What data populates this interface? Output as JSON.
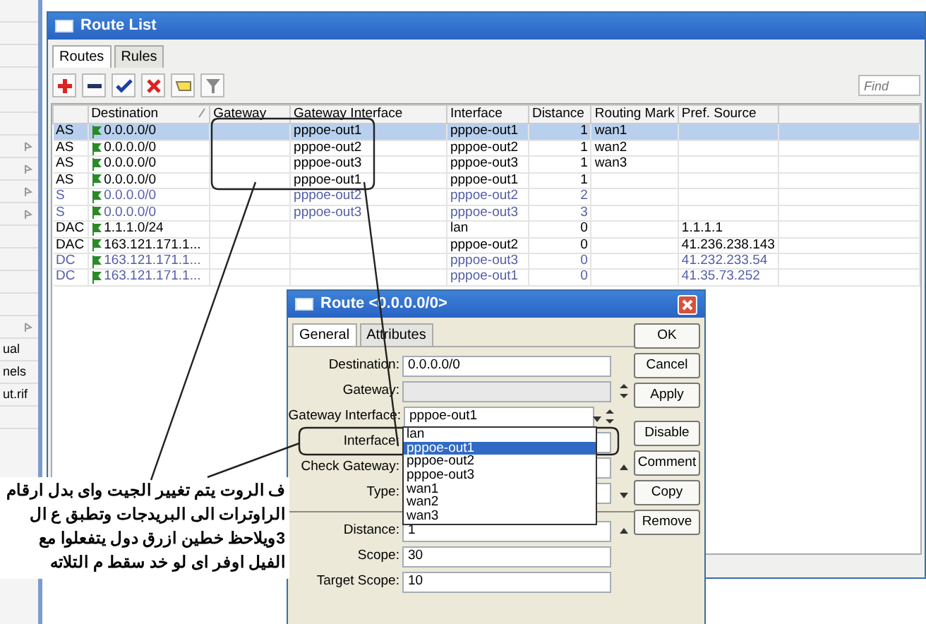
{
  "sidebar": {
    "items": [
      {
        "label": "ual"
      },
      {
        "label": "nels"
      },
      {
        "label": "ut.rif"
      }
    ]
  },
  "route_list": {
    "title": "Route List",
    "tabs": [
      {
        "label": "Routes",
        "selected": true
      },
      {
        "label": "Rules",
        "selected": false
      }
    ],
    "find": {
      "placeholder": "Find"
    },
    "columns": [
      "Destination",
      "Gateway",
      "Gateway Interface",
      "Interface",
      "Distance",
      "Routing Mark",
      "Pref. Source"
    ],
    "rows": [
      {
        "type": "AS",
        "destination": "0.0.0.0/0",
        "gateway_interface": "pppoe-out1",
        "interface": "pppoe-out1",
        "distance": "1",
        "routing_mark": "wan1",
        "selected": true,
        "inactive": false
      },
      {
        "type": "AS",
        "destination": "0.0.0.0/0",
        "gateway_interface": "pppoe-out2",
        "interface": "pppoe-out2",
        "distance": "1",
        "routing_mark": "wan2",
        "selected": false,
        "inactive": false
      },
      {
        "type": "AS",
        "destination": "0.0.0.0/0",
        "gateway_interface": "pppoe-out3",
        "interface": "pppoe-out3",
        "distance": "1",
        "routing_mark": "wan3",
        "selected": false,
        "inactive": false
      },
      {
        "type": "AS",
        "destination": "0.0.0.0/0",
        "gateway_interface": "pppoe-out1",
        "interface": "pppoe-out1",
        "distance": "1",
        "selected": false,
        "inactive": false
      },
      {
        "type": "S",
        "destination": "0.0.0.0/0",
        "gateway_interface": "pppoe-out2",
        "interface": "pppoe-out2",
        "distance": "2",
        "selected": false,
        "inactive": true
      },
      {
        "type": "S",
        "destination": "0.0.0.0/0",
        "gateway_interface": "pppoe-out3",
        "interface": "pppoe-out3",
        "distance": "3",
        "selected": false,
        "inactive": true
      },
      {
        "type": "DAC",
        "destination": "1.1.1.0/24",
        "interface": "lan",
        "distance": "0",
        "pref_source": "1.1.1.1",
        "selected": false,
        "inactive": false
      },
      {
        "type": "DAC",
        "destination": "163.121.171.1...",
        "interface": "pppoe-out2",
        "distance": "0",
        "pref_source": "41.236.238.143",
        "selected": false,
        "inactive": false
      },
      {
        "type": "DC",
        "destination": "163.121.171.1...",
        "interface": "pppoe-out3",
        "distance": "0",
        "pref_source": "41.232.233.54",
        "selected": false,
        "inactive": true
      },
      {
        "type": "DC",
        "destination": "163.121.171.1...",
        "interface": "pppoe-out1",
        "distance": "0",
        "pref_source": "41.35.73.252",
        "selected": false,
        "inactive": true
      }
    ]
  },
  "route_dialog": {
    "title": "Route <0.0.0.0/0>",
    "tabs": [
      {
        "label": "General",
        "selected": true
      },
      {
        "label": "Attributes",
        "selected": false
      }
    ],
    "field_groups": [
      [
        {
          "label": "Destination:",
          "value": "0.0.0.0/0",
          "kind": "text"
        },
        {
          "label": "Gateway:",
          "kind": "spin"
        },
        {
          "label": "Gateway Interface:",
          "value": "pppoe-out1",
          "kind": "dropdown-spin"
        },
        {
          "label": "Interface:",
          "kind": "text"
        },
        {
          "label": "Check Gateway:",
          "kind": "collapsible"
        },
        {
          "label": "Type:",
          "kind": "dropdown"
        }
      ],
      [
        {
          "label": "Distance:",
          "value": "1",
          "kind": "collapsible"
        },
        {
          "label": "Scope:",
          "value": "30",
          "kind": "text"
        },
        {
          "label": "Target Scope:",
          "value": "10",
          "kind": "text"
        }
      ]
    ],
    "dropdown_list": [
      {
        "label": "lan",
        "selected": false
      },
      {
        "label": "pppoe-out1",
        "selected": true
      },
      {
        "label": "pppoe-out2",
        "selected": false
      },
      {
        "label": "pppoe-out3",
        "selected": false
      },
      {
        "label": "wan1",
        "selected": false
      },
      {
        "label": "wan2",
        "selected": false
      },
      {
        "label": "wan3",
        "selected": false
      }
    ],
    "buttons": [
      "OK",
      "Cancel",
      "Apply",
      "Disable",
      "Comment",
      "Copy",
      "Remove"
    ]
  },
  "annotation": {
    "lines": [
      "ف الروت يتم تغيير الجيت واى بدل ارقام",
      "الراوترات الى البريدجات وتطبق ع ال",
      "3ويلاحظ خطين ازرق دول يتفعلوا مع",
      "الفيل اوفر اى لو خد سقط م التلاته"
    ]
  }
}
